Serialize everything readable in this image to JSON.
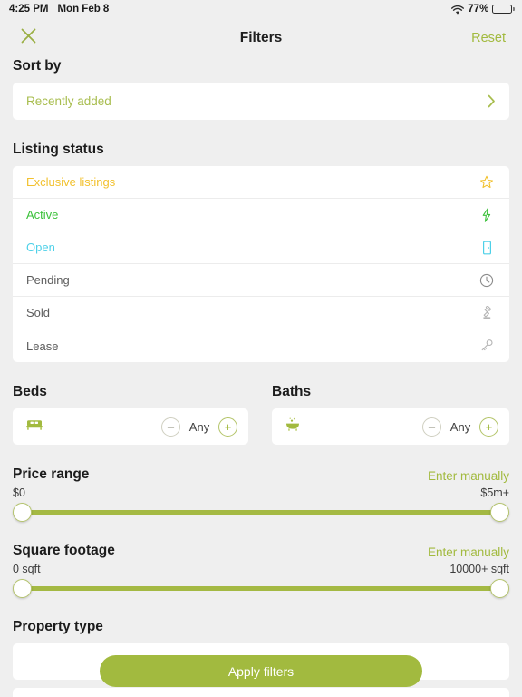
{
  "statusbar": {
    "time": "4:25 PM",
    "date": "Mon Feb 8",
    "wifi_icon": "wifi-icon",
    "battery_percent": "77%",
    "battery_level": 77
  },
  "navbar": {
    "close_icon": "close-icon",
    "title": "Filters",
    "reset_label": "Reset"
  },
  "sort": {
    "label": "Sort by",
    "value": "Recently added",
    "chevron_icon": "chevron-right-icon"
  },
  "listing_status": {
    "label": "Listing status",
    "items": [
      {
        "label": "Exclusive listings",
        "color": "#f2c12e",
        "icon": "star-icon"
      },
      {
        "label": "Active",
        "color": "#3cc13b",
        "icon": "lightning-bolt-icon"
      },
      {
        "label": "Open",
        "color": "#4dd0e8",
        "icon": "open-door-icon"
      },
      {
        "label": "Pending",
        "color": "#5d5d5d",
        "icon": "clock-icon"
      },
      {
        "label": "Sold",
        "color": "#5d5d5d",
        "icon": "gavel-icon"
      },
      {
        "label": "Lease",
        "color": "#5d5d5d",
        "icon": "key-icon"
      }
    ]
  },
  "beds": {
    "label": "Beds",
    "icon": "bed-icon",
    "minus_label": "–",
    "value": "Any",
    "plus_label": "+"
  },
  "baths": {
    "label": "Baths",
    "icon": "bathtub-icon",
    "minus_label": "–",
    "value": "Any",
    "plus_label": "+"
  },
  "price_range": {
    "label": "Price range",
    "enter_manually": "Enter manually",
    "min_value": "$0",
    "max_value": "$5m+"
  },
  "square_footage": {
    "label": "Square footage",
    "enter_manually": "Enter manually",
    "min_value": "0 sqft",
    "max_value": "10000+ sqft"
  },
  "property_type": {
    "label": "Property type"
  },
  "footer": {
    "apply_label": "Apply filters"
  },
  "colors": {
    "accent": "#a2ba3f",
    "background": "#efefef",
    "card": "#ffffff"
  }
}
